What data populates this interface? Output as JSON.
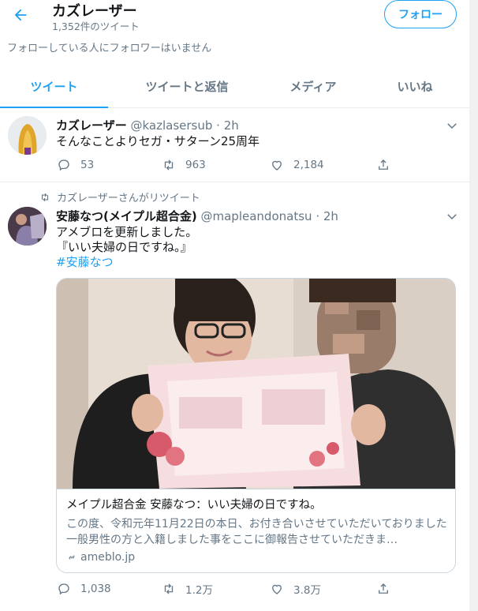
{
  "header": {
    "title": "カズレーザー",
    "tweet_count": "1,352件のツイート",
    "follow_label": "フォロー"
  },
  "follow_note": "フォローしている人にフォロワーはいません",
  "tabs": [
    {
      "label": "ツイート",
      "active": true
    },
    {
      "label": "ツイートと返信",
      "active": false
    },
    {
      "label": "メディア",
      "active": false
    },
    {
      "label": "いいね",
      "active": false
    }
  ],
  "tweets": [
    {
      "name": "カズレーザー",
      "handle": "@kazlasersub",
      "dot": "·",
      "time": "2h",
      "text": "そんなことよりセガ・サターン25周年",
      "replies": "53",
      "retweets": "963",
      "likes": "2,184"
    },
    {
      "retweet_label": "カズレーザーさんがリツイート",
      "name": "安藤なつ(メイプル超合金)",
      "handle": "@mapleandonatsu",
      "dot": "·",
      "time": "2h",
      "text_line1": "アメブロを更新しました。",
      "text_line2": "『いい夫婦の日ですね。』",
      "hashtag": "#安藤なつ",
      "card": {
        "title": "メイプル超合金 安藤なつ：いい夫婦の日ですね。",
        "description": "この度、令和元年11月22日の本日、お付き合いさせていただいておりました一般男性の方と入籍しました事をここに御報告させていただきま…",
        "domain": "ameblo.jp"
      },
      "replies": "1,038",
      "retweets": "1.2万",
      "likes": "3.8万"
    }
  ],
  "colors": {
    "accent": "#1da1f2",
    "secondary_text": "#657786",
    "border": "#e6ecf0"
  },
  "icons": [
    "back-arrow-icon",
    "reply-icon",
    "retweet-icon",
    "like-icon",
    "share-icon",
    "chevron-down-icon",
    "link-icon"
  ]
}
